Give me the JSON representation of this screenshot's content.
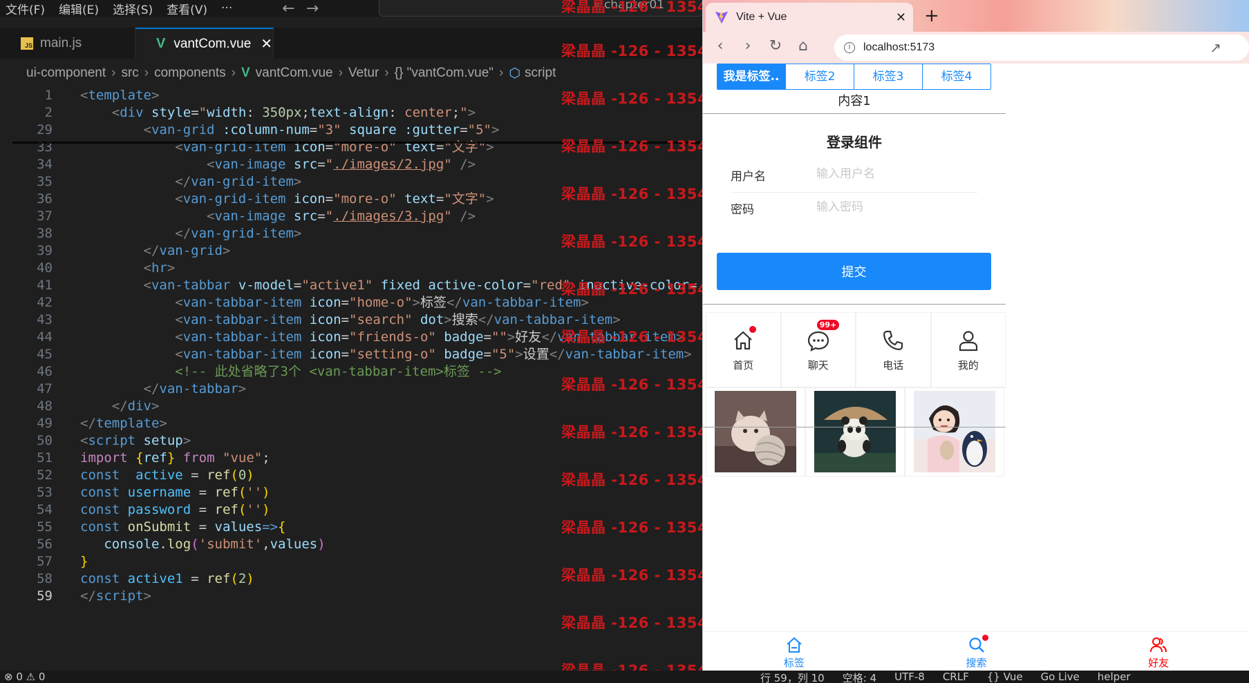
{
  "vscode": {
    "menu": [
      "文件(F)",
      "编辑(E)",
      "选择(S)",
      "查看(V)",
      "···"
    ],
    "command_center": "chapter01",
    "tabs": [
      {
        "label": "main.js",
        "icon": "js-icon"
      },
      {
        "label": "vantCom.vue",
        "icon": "vue-icon",
        "active": true
      }
    ],
    "breadcrumb": [
      "ui-component",
      "src",
      "components",
      "vantCom.vue",
      "Vetur",
      "{} \"vantCom.vue\"",
      "script"
    ],
    "watermark": "梁晶晶 -126 - 1354",
    "status_left": "⊗ 0 ⚠ 0",
    "status_right": [
      "行 59，列 10",
      "空格: 4",
      "UTF-8",
      "CRLF",
      "{} Vue",
      "Go Live",
      "helper"
    ]
  },
  "browser": {
    "tab_title": "Vite + Vue",
    "url": "localhost:5173",
    "tabs": [
      "我是标签..",
      "标签2",
      "标签3",
      "标签4"
    ],
    "tab_content": "内容1",
    "login": {
      "title": "登录组件",
      "username_label": "用户名",
      "username_placeholder": "输入用户名",
      "password_label": "密码",
      "password_placeholder": "输入密码",
      "submit": "提交"
    },
    "grid": [
      {
        "label": "首页",
        "icon": "home-icon",
        "dot": true
      },
      {
        "label": "聊天",
        "icon": "chat-icon",
        "badge": "99+"
      },
      {
        "label": "电话",
        "icon": "phone-icon"
      },
      {
        "label": "我的",
        "icon": "user-icon"
      }
    ],
    "images": [
      "kitten-image",
      "panda-image",
      "girl-image"
    ],
    "tabbar": [
      {
        "label": "标签",
        "icon": "home-icon"
      },
      {
        "label": "搜索",
        "icon": "search-icon",
        "dot": true
      },
      {
        "label": "好友",
        "icon": "friends-icon"
      }
    ]
  }
}
